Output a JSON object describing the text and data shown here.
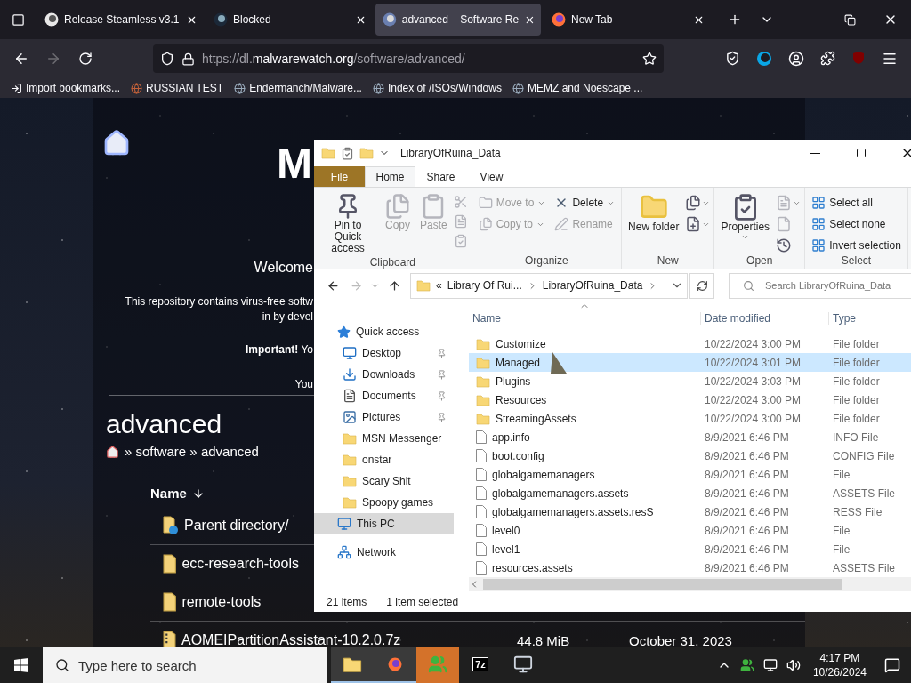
{
  "browser": {
    "tabs": [
      {
        "title": "Release Steamless v3.1",
        "selected": false
      },
      {
        "title": "Blocked",
        "selected": false
      },
      {
        "title": "advanced – Software Re",
        "selected": true
      },
      {
        "title": "New Tab",
        "selected": false
      }
    ],
    "url": {
      "prefix": "https://dl.",
      "domain": "malwarewatch.org",
      "path": "/software/advanced/"
    },
    "bookmarks": [
      "Import bookmarks...",
      "RUSSIAN TEST",
      "Endermanch/Malware...",
      "Index of /ISOs/Windows",
      "MEMZ and Noescape ..."
    ]
  },
  "page": {
    "logo": "M",
    "welcome": "Welcome",
    "intro": [
      "This repository contains virus-free softw",
      "in by devel"
    ],
    "important": "**Important!** Yo",
    "note": "You",
    "heading": "advanced",
    "breadcrumb": "» software » advanced",
    "name_header": "Name",
    "entries": [
      {
        "name": "Parent directory/",
        "kind": "parent"
      },
      {
        "name": "ecc-research-tools",
        "kind": "folder"
      },
      {
        "name": "remote-tools",
        "kind": "folder"
      },
      {
        "name": "AOMEIPartitionAssistant-10.2.0.7z",
        "kind": "archive",
        "size": "44.8 MiB",
        "date": "October 31, 2023"
      }
    ]
  },
  "explorer": {
    "title": "LibraryOfRuina_Data",
    "ribbon_tabs": [
      {
        "label": "File",
        "kind": "file",
        "selected": false
      },
      {
        "label": "Home",
        "kind": "tab",
        "selected": true
      },
      {
        "label": "Share",
        "kind": "tab",
        "selected": false
      },
      {
        "label": "View",
        "kind": "tab",
        "selected": false
      }
    ],
    "ribbon_groups": [
      {
        "label": "Clipboard",
        "columns": [
          [
            {
              "label": "Pin to Quick access",
              "kind": "large",
              "disabled": false
            }
          ],
          [
            {
              "label": "Copy",
              "kind": "large",
              "disabled": true
            }
          ],
          [
            {
              "label": "Paste",
              "kind": "large",
              "disabled": true
            }
          ],
          [
            {
              "kind": "icon",
              "disabled": true
            },
            {
              "kind": "icon",
              "disabled": true
            },
            {
              "kind": "icon",
              "disabled": true
            }
          ]
        ]
      },
      {
        "label": "Organize",
        "columns": [
          [
            {
              "label": "Move to",
              "kind": "small",
              "disabled": true,
              "menu": true
            },
            {
              "label": "Copy to",
              "kind": "small",
              "disabled": true,
              "menu": true
            }
          ],
          [
            {
              "label": "Delete",
              "kind": "small",
              "disabled": false,
              "menu": true
            },
            {
              "label": "Rename",
              "kind": "small",
              "disabled": true
            }
          ]
        ]
      },
      {
        "label": "New",
        "columns": [
          [
            {
              "label": "New folder",
              "kind": "large",
              "disabled": false
            }
          ],
          [
            {
              "kind": "icon",
              "disabled": false,
              "menu": true
            },
            {
              "kind": "icon",
              "disabled": false,
              "menu": true
            }
          ]
        ]
      },
      {
        "label": "Open",
        "columns": [
          [
            {
              "label": "Properties",
              "kind": "large",
              "disabled": false,
              "menu": true
            }
          ],
          [
            {
              "kind": "icon",
              "disabled": true,
              "menu": true
            },
            {
              "kind": "icon",
              "disabled": true
            },
            {
              "kind": "icon",
              "disabled": false
            }
          ]
        ]
      },
      {
        "label": "Select",
        "columns": [
          [
            {
              "label": "Select all",
              "kind": "small",
              "disabled": false
            },
            {
              "label": "Select none",
              "kind": "small",
              "disabled": false
            },
            {
              "label": "Invert selection",
              "kind": "small",
              "disabled": false
            }
          ]
        ]
      }
    ],
    "address": {
      "overflow": "«",
      "parts": [
        "Library Of Rui...",
        "LibraryOfRuina_Data"
      ]
    },
    "search": {
      "placeholder": "Search LibraryOfRuina_Data"
    },
    "nav": [
      {
        "label": "Quick access",
        "kind": "star",
        "selected": false,
        "children": [
          {
            "label": "Desktop",
            "kind": "desktop",
            "pinned": true,
            "selected": false
          },
          {
            "label": "Downloads",
            "kind": "download",
            "pinned": true,
            "selected": false
          },
          {
            "label": "Documents",
            "kind": "document",
            "pinned": true,
            "selected": false
          },
          {
            "label": "Pictures",
            "kind": "pictures",
            "pinned": true,
            "selected": false
          },
          {
            "label": "MSN Messenger",
            "kind": "folder",
            "pinned": false,
            "selected": false
          },
          {
            "label": "onstar",
            "kind": "folder",
            "pinned": false,
            "selected": false
          },
          {
            "label": "Scary Shit",
            "kind": "folder",
            "pinned": false,
            "selected": false
          },
          {
            "label": "Spoopy games",
            "kind": "folder",
            "pinned": false,
            "selected": false
          }
        ]
      },
      {
        "label": "This PC",
        "kind": "pc",
        "selected": true
      },
      {
        "label": "Network",
        "kind": "network",
        "selected": false
      }
    ],
    "columns": [
      {
        "label": "Name",
        "sorted": true
      },
      {
        "label": "Date modified",
        "sorted": false
      },
      {
        "label": "Type",
        "sorted": false
      }
    ],
    "files": [
      {
        "name": "Customize",
        "date": "10/22/2024 3:00 PM",
        "type": "File folder",
        "kind": "folder",
        "selected": false
      },
      {
        "name": "Managed",
        "date": "10/22/2024 3:01 PM",
        "type": "File folder",
        "kind": "folder",
        "selected": true
      },
      {
        "name": "Plugins",
        "date": "10/22/2024 3:03 PM",
        "type": "File folder",
        "kind": "folder",
        "selected": false
      },
      {
        "name": "Resources",
        "date": "10/22/2024 3:00 PM",
        "type": "File folder",
        "kind": "folder",
        "selected": false
      },
      {
        "name": "StreamingAssets",
        "date": "10/22/2024 3:00 PM",
        "type": "File folder",
        "kind": "folder",
        "selected": false
      },
      {
        "name": "app.info",
        "date": "8/9/2021 6:46 PM",
        "type": "INFO File",
        "kind": "file",
        "selected": false
      },
      {
        "name": "boot.config",
        "date": "8/9/2021 6:46 PM",
        "type": "CONFIG File",
        "kind": "file",
        "selected": false
      },
      {
        "name": "globalgamemanagers",
        "date": "8/9/2021 6:46 PM",
        "type": "File",
        "kind": "file",
        "selected": false
      },
      {
        "name": "globalgamemanagers.assets",
        "date": "8/9/2021 6:46 PM",
        "type": "ASSETS File",
        "kind": "file",
        "selected": false
      },
      {
        "name": "globalgamemanagers.assets.resS",
        "date": "8/9/2021 6:46 PM",
        "type": "RESS File",
        "kind": "file",
        "selected": false
      },
      {
        "name": "level0",
        "date": "8/9/2021 6:46 PM",
        "type": "File",
        "kind": "file",
        "selected": false
      },
      {
        "name": "level1",
        "date": "8/9/2021 6:46 PM",
        "type": "File",
        "kind": "file",
        "selected": false
      },
      {
        "name": "resources.assets",
        "date": "8/9/2021 6:46 PM",
        "type": "ASSETS File",
        "kind": "file",
        "selected": false
      }
    ],
    "status": {
      "count": "21 items",
      "selection": "1 item selected"
    }
  },
  "taskbar": {
    "search": {
      "placeholder": "Type here to search"
    },
    "apps": [
      {
        "kind": "explorer",
        "running": true,
        "flashing": false
      },
      {
        "kind": "firefox",
        "running": true,
        "flashing": false
      },
      {
        "kind": "messenger",
        "running": false,
        "flashing": true
      },
      {
        "kind": "archiver",
        "running": false,
        "flashing": false,
        "label": "7z"
      },
      {
        "kind": "monitor",
        "running": false,
        "flashing": false
      }
    ],
    "time": "4:17 PM",
    "date": "10/26/2024"
  }
}
